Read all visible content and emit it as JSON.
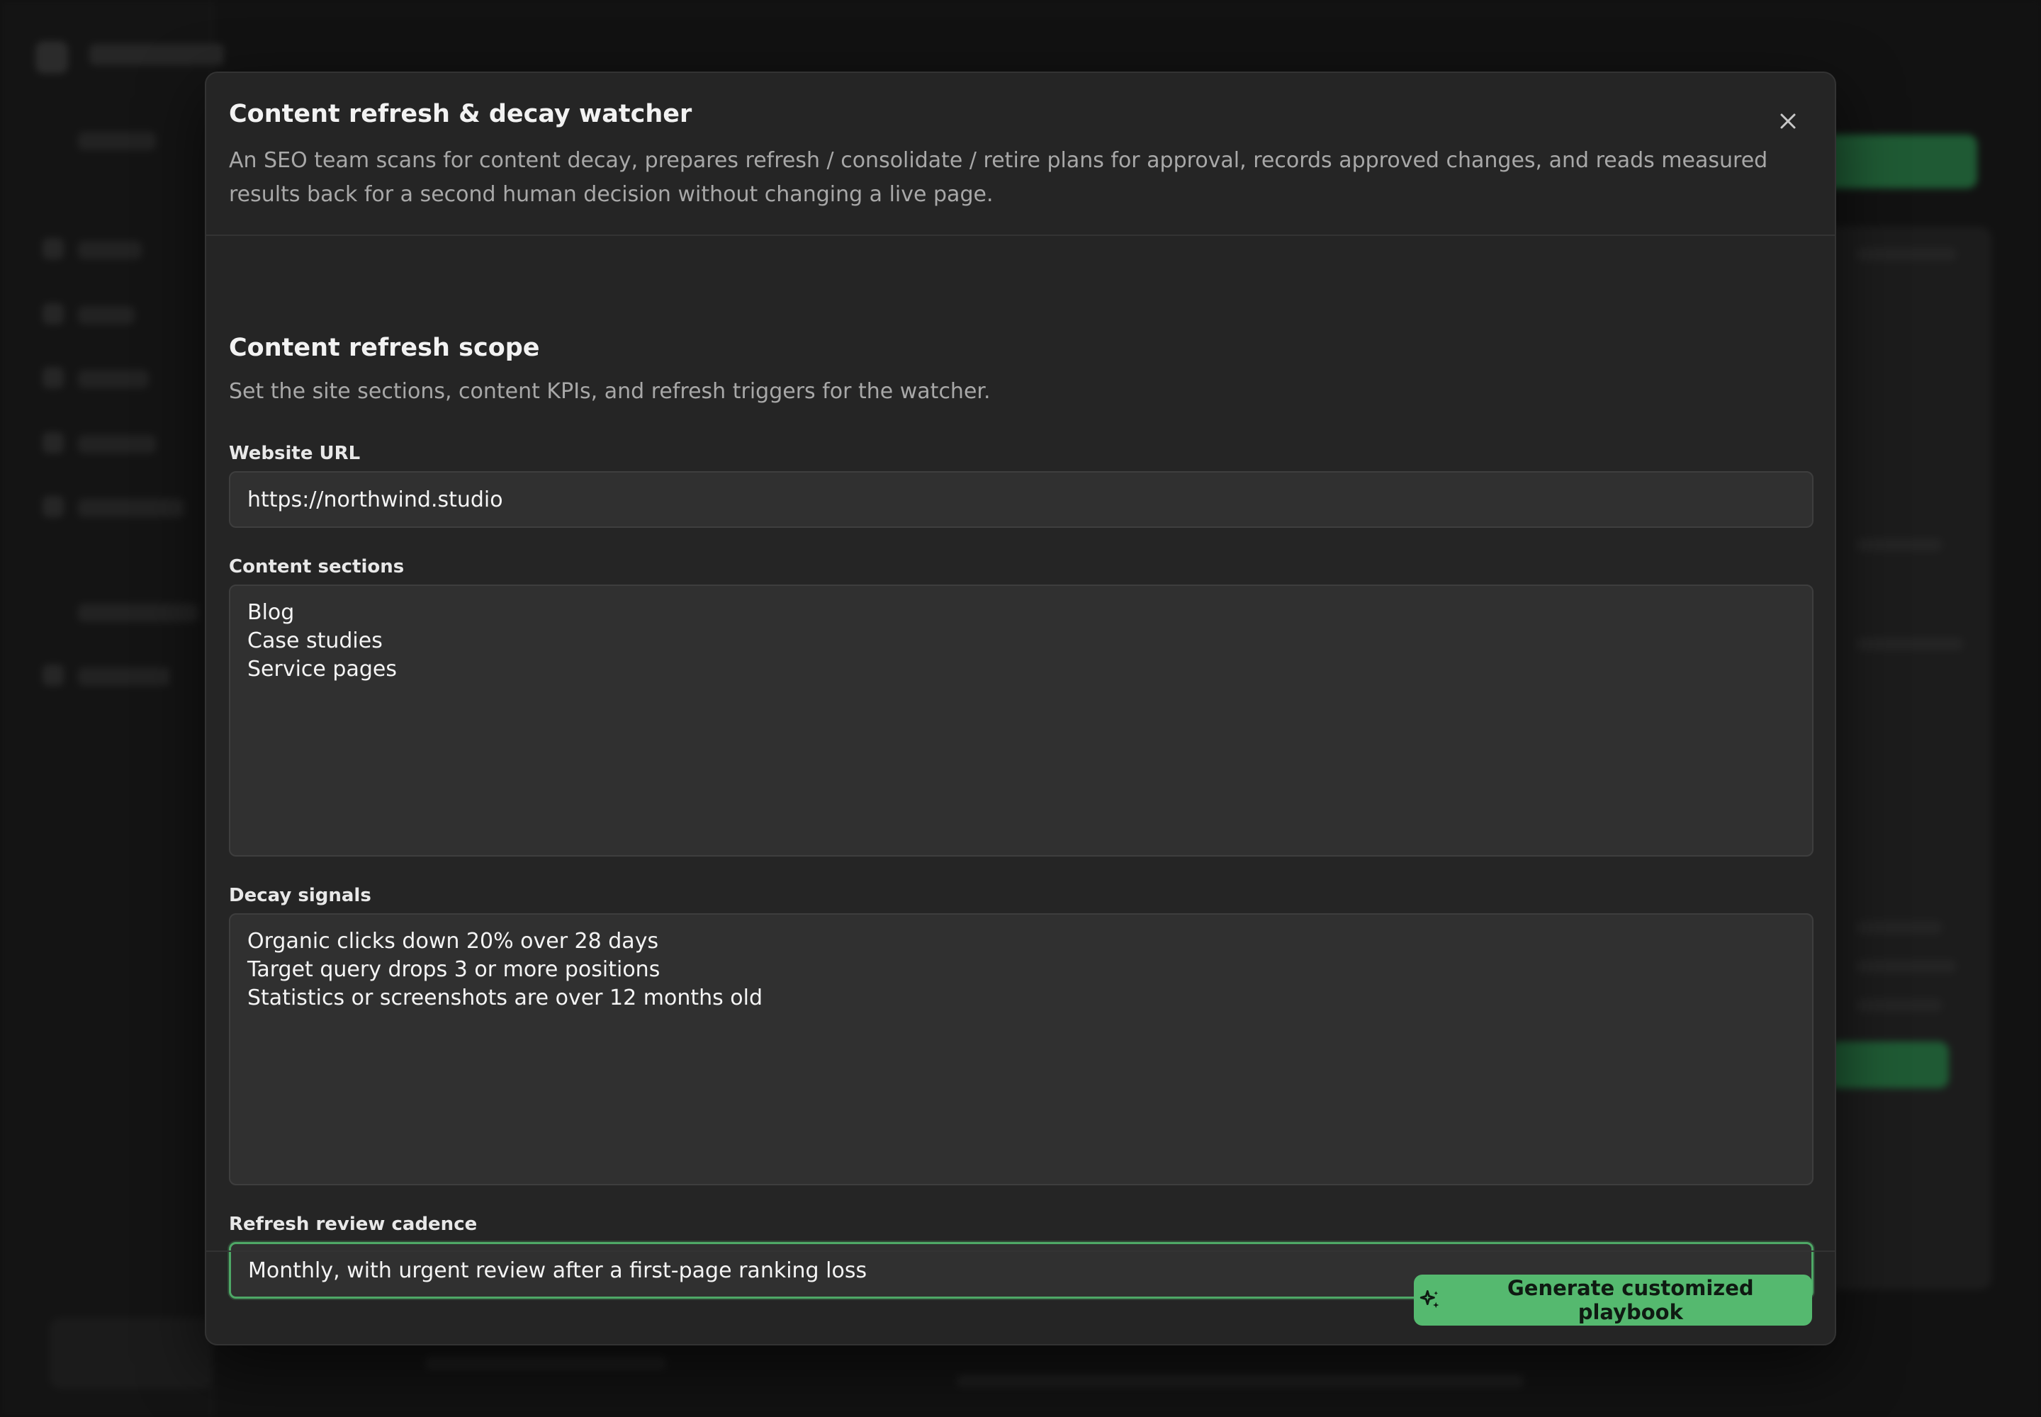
{
  "modal": {
    "title": "Content refresh & decay watcher",
    "description": "An SEO team scans for content decay, prepares refresh / consolidate / retire plans for approval, records approved changes, and reads measured results back for a second human decision without changing a live page.",
    "close_icon": "close-icon"
  },
  "scope": {
    "title": "Content refresh scope",
    "description": "Set the site sections, content KPIs, and refresh triggers for the watcher."
  },
  "fields": {
    "website_url": {
      "label": "Website URL",
      "value": "https://northwind.studio"
    },
    "content_sections": {
      "label": "Content sections",
      "value": "Blog\nCase studies\nService pages"
    },
    "decay_signals": {
      "label": "Decay signals",
      "value": "Organic clicks down 20% over 28 days\nTarget query drops 3 or more positions\nStatistics or screenshots are over 12 months old"
    },
    "review_cadence": {
      "label": "Refresh review cadence",
      "value": "Monthly, with urgent review after a first-page ranking loss"
    }
  },
  "footer": {
    "generate_label": "Generate customized playbook",
    "generate_icon": "sparkles-icon"
  },
  "colors": {
    "accent": "#55b96f",
    "focus_border": "#4ea866",
    "modal_bg": "#252525",
    "input_bg": "#303030"
  }
}
